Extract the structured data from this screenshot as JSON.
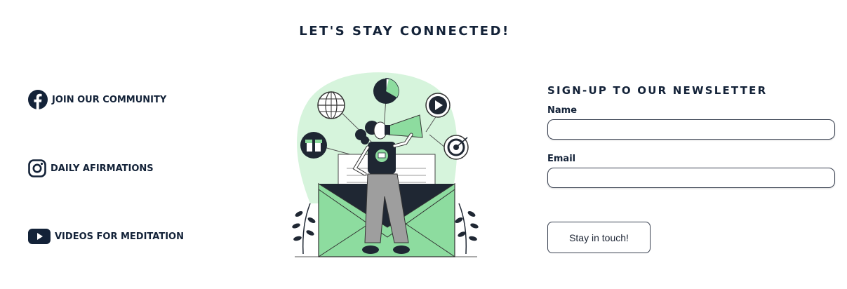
{
  "header": {
    "title": "LET'S STAY CONNECTED!"
  },
  "social": [
    {
      "label": "JOIN OUR COMMUNITY",
      "icon": "facebook-icon"
    },
    {
      "label": "DAILY AFIRMATIONS",
      "icon": "instagram-icon"
    },
    {
      "label": "VIDEOS FOR MEDITATION",
      "icon": "youtube-icon"
    }
  ],
  "newsletter": {
    "title": "SIGN-UP TO OUR NEWSLETTER",
    "name_label": "Name",
    "name_value": "",
    "email_label": "Email",
    "email_value": "",
    "submit_label": "Stay in touch!"
  },
  "colors": {
    "text": "#132238",
    "accent_green": "#8ddc9f",
    "light_green": "#d6f4dc",
    "border": "#3a4252"
  }
}
